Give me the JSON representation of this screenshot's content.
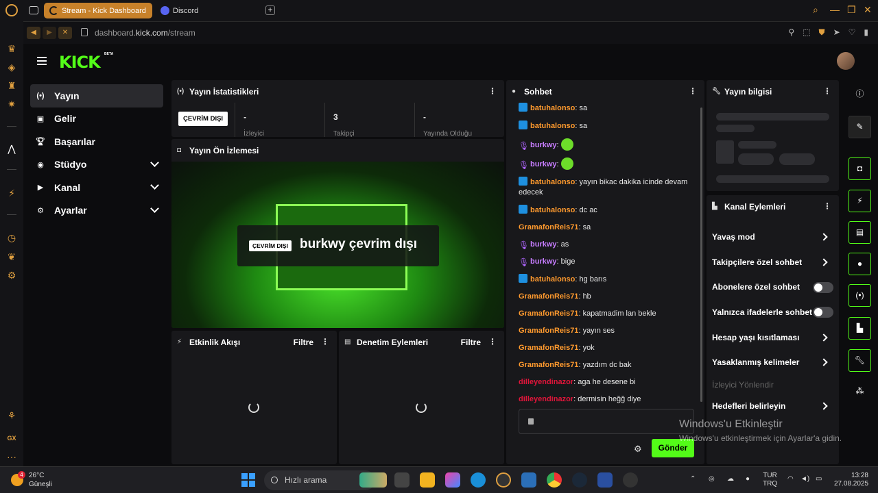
{
  "browser": {
    "tabs": [
      {
        "label": "Stream - Kick Dashboard",
        "active": true
      },
      {
        "label": "Discord",
        "active": false
      }
    ],
    "url_prefix": "dashboard.",
    "url_domain": "kick.com",
    "url_path": "/stream",
    "window_controls": [
      "search-icon",
      "minimize-icon",
      "restore-icon",
      "close-icon"
    ]
  },
  "header": {
    "logo": "KICK",
    "badge": "BETA"
  },
  "sidebar": {
    "items": [
      {
        "label": "Yayın",
        "icon": "broadcast-icon",
        "selected": true
      },
      {
        "label": "Gelir",
        "icon": "revenue-icon"
      },
      {
        "label": "Başarılar",
        "icon": "trophy-icon"
      },
      {
        "label": "Stüdyo",
        "icon": "studio-icon",
        "expandable": true
      },
      {
        "label": "Kanal",
        "icon": "channel-icon",
        "expandable": true
      },
      {
        "label": "Ayarlar",
        "icon": "settings-icon",
        "expandable": true
      }
    ]
  },
  "stats": {
    "title": "Yayın İstatistikleri",
    "status": "ÇEVRİM DIŞI",
    "cells": [
      {
        "value": "-",
        "label": "İzleyici"
      },
      {
        "value": "3",
        "label": "Takipçi"
      },
      {
        "value": "-",
        "label": "Yayında Olduğu"
      }
    ]
  },
  "preview": {
    "title": "Yayın Ön İzlemesi",
    "badge": "ÇEVRİM DIŞI",
    "text": "burkwy çevrim dışı"
  },
  "activity": {
    "title": "Etkinlik Akışı",
    "filter": "Filtre"
  },
  "moderation": {
    "title": "Denetim Eylemleri",
    "filter": "Filtre"
  },
  "chat": {
    "title": "Sohbet",
    "messages": [
      {
        "user": "batuhalonso",
        "text": "sa",
        "badge": "kick",
        "style": "u1"
      },
      {
        "user": "batuhalonso",
        "text": "sa",
        "badge": "kick",
        "style": "u1"
      },
      {
        "user": "burkwy",
        "text": "",
        "badge": "mic",
        "style": "u3",
        "emote": true
      },
      {
        "user": "burkwy",
        "text": "",
        "badge": "mic",
        "style": "u3",
        "emote": true
      },
      {
        "user": "batuhalonso",
        "text": "yayın bikac dakika icinde devam edecek",
        "badge": "kick",
        "style": "u1"
      },
      {
        "user": "batuhalonso",
        "text": "dc ac",
        "badge": "kick",
        "style": "u1"
      },
      {
        "user": "GramafonReis71",
        "text": "sa",
        "badge": "",
        "style": "u2"
      },
      {
        "user": "burkwy",
        "text": "as",
        "badge": "mic",
        "style": "u3"
      },
      {
        "user": "burkwy",
        "text": "bige",
        "badge": "mic",
        "style": "u3"
      },
      {
        "user": "batuhalonso",
        "text": "hg barıs",
        "badge": "kick",
        "style": "u1"
      },
      {
        "user": "GramafonReis71",
        "text": "hb",
        "badge": "",
        "style": "u2"
      },
      {
        "user": "GramafonReis71",
        "text": "kapatmadim lan bekle",
        "badge": "",
        "style": "u2"
      },
      {
        "user": "GramafonReis71",
        "text": "yayın ses",
        "badge": "",
        "style": "u2"
      },
      {
        "user": "GramafonReis71",
        "text": "yok",
        "badge": "",
        "style": "u2"
      },
      {
        "user": "GramafonReis71",
        "text": "yazdım dc bak",
        "badge": "",
        "style": "u2"
      },
      {
        "user": "dilleyendinazor",
        "text": "aga he desene bi",
        "badge": "",
        "style": "u4"
      },
      {
        "user": "dilleyendinazor",
        "text": "dermisin heğğ diye",
        "badge": "",
        "style": "u4"
      }
    ],
    "send": "Gönder"
  },
  "stream_info": {
    "title": "Yayın bilgisi"
  },
  "channel_actions": {
    "title": "Kanal Eylemleri",
    "items": [
      {
        "label": "Yavaş mod",
        "control": "chevron"
      },
      {
        "label": "Takipçilere özel sohbet",
        "control": "chevron"
      },
      {
        "label": "Abonelere özel sohbet",
        "control": "toggle"
      },
      {
        "label": "Yalnızca ifadelerle sohbet",
        "control": "toggle"
      },
      {
        "label": "Hesap yaşı kısıtlaması",
        "control": "chevron"
      },
      {
        "label": "Yasaklanmış kelimeler",
        "control": "chevron"
      },
      {
        "label": "İzleyici Yönlendir",
        "control": "none",
        "disabled": true
      },
      {
        "label": "Hedefleri belirleyin",
        "control": "chevron"
      }
    ]
  },
  "right_rail": [
    "info-icon",
    "pencil-icon",
    "camera-icon",
    "lightning-icon",
    "notes-icon",
    "chat-icon",
    "broadcast-icon",
    "layout-icon",
    "wrench-icon",
    "scatter-icon"
  ],
  "watermark": {
    "title": "Windows'u Etkinleştir",
    "subtitle": "Windows'u etkinleştirmek için Ayarlar'a gidin."
  },
  "taskbar": {
    "temp": "26°C",
    "weather": "Güneşli",
    "badge": "4",
    "search": "Hızlı arama",
    "lang1": "TUR",
    "lang2": "TRQ",
    "time": "13:28",
    "date": "27.08.2025"
  }
}
